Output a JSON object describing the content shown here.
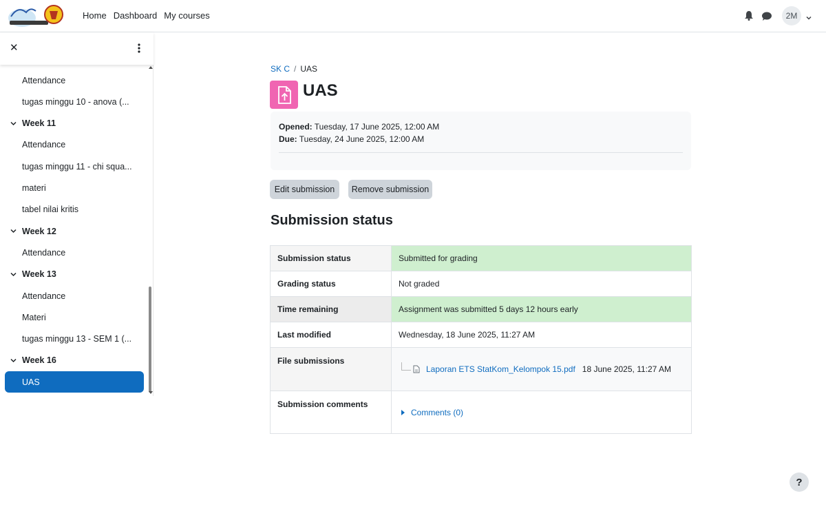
{
  "header": {
    "logo_alt": "e-Learning logo",
    "nav": [
      "Home",
      "Dashboard",
      "My courses"
    ],
    "avatar_initials": "2M"
  },
  "course_index": {
    "items": [
      {
        "type": "item",
        "label": "Attendance"
      },
      {
        "type": "item",
        "label": "tugas minggu 10 - anova (..."
      },
      {
        "type": "section",
        "label": "Week 11"
      },
      {
        "type": "item",
        "label": "Attendance"
      },
      {
        "type": "item",
        "label": "tugas minggu 11 - chi squa..."
      },
      {
        "type": "item",
        "label": "materi"
      },
      {
        "type": "item",
        "label": "tabel nilai kritis"
      },
      {
        "type": "section",
        "label": "Week 12"
      },
      {
        "type": "item",
        "label": "Attendance"
      },
      {
        "type": "section",
        "label": "Week 13"
      },
      {
        "type": "item",
        "label": "Attendance"
      },
      {
        "type": "item",
        "label": "Materi"
      },
      {
        "type": "item",
        "label": "tugas minggu 13 - SEM 1 (..."
      },
      {
        "type": "section",
        "label": "Week 16"
      },
      {
        "type": "active",
        "label": "UAS"
      }
    ]
  },
  "breadcrumb": {
    "course": "SK C",
    "separator": "/",
    "current": "UAS"
  },
  "page": {
    "title": "UAS",
    "icon": "assignment-upload-icon",
    "icon_color": "#f065b2"
  },
  "dates": {
    "opened_label": "Opened:",
    "opened_value": " Tuesday, 17 June 2025, 12:00 AM",
    "due_label": "Due:",
    "due_value": " Tuesday, 24 June 2025, 12:00 AM"
  },
  "actions": {
    "edit": "Edit submission",
    "remove": "Remove submission"
  },
  "submission": {
    "heading": "Submission status",
    "rows": {
      "status_label": "Submission status",
      "status_value": "Submitted for grading",
      "grading_label": "Grading status",
      "grading_value": "Not graded",
      "time_label": "Time remaining",
      "time_value": "Assignment was submitted 5 days 12 hours early",
      "modified_label": "Last modified",
      "modified_value": "Wednesday, 18 June 2025, 11:27 AM",
      "files_label": "File submissions",
      "file_name": "Laporan ETS StatKom_Kelompok 15.pdf",
      "file_date": "18 June 2025, 11:27 AM",
      "comments_label": "Submission comments",
      "comments_link": "Comments (0)"
    }
  },
  "colors": {
    "brand": "#0f6cbf",
    "success_bg": "#cfefcf",
    "button_bg": "#ced4da"
  },
  "help": "?"
}
